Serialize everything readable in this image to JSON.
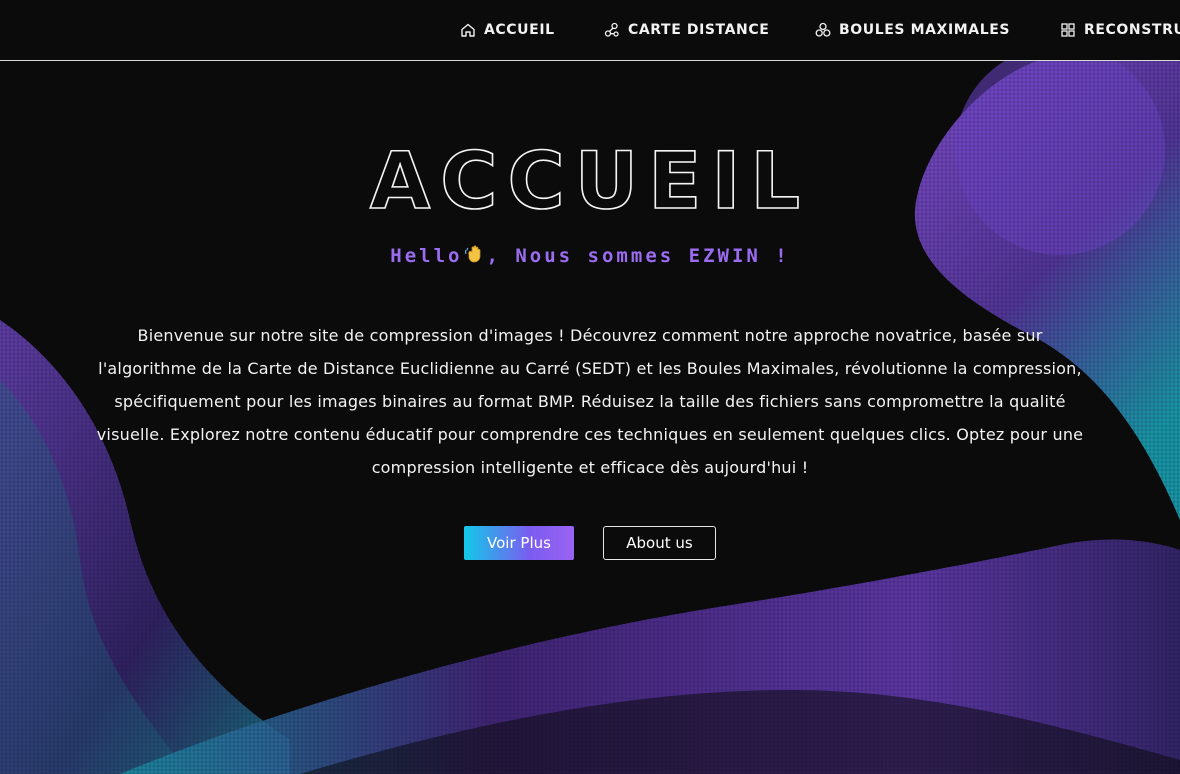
{
  "nav": {
    "items": [
      {
        "label": "ACCUEIL",
        "icon": "home-icon"
      },
      {
        "label": "CARTE DISTANCE",
        "icon": "network-icon"
      },
      {
        "label": "BOULES MAXIMALES",
        "icon": "spheres-icon"
      },
      {
        "label": "RECONSTRU",
        "icon": "blocks-icon"
      }
    ]
  },
  "hero": {
    "title": "ACCUEIL",
    "subtitle_before": "Hello",
    "subtitle_after": ", Nous sommes EZWIN !",
    "description": "Bienvenue sur notre site de compression d'images ! Découvrez comment notre approche novatrice, basée sur l'algorithme de la Carte de Distance Euclidienne au Carré (SEDT) et les Boules Maximales, révolutionne la compression, spécifiquement pour les images binaires au format BMP. Réduisez la taille des fichiers sans compromettre la qualité visuelle. Explorez notre contenu éducatif pour comprendre ces techniques en seulement quelques clics. Optez pour une compression intelligente et efficace dès aujourd'hui !"
  },
  "buttons": {
    "primary": "Voir Plus",
    "secondary": "About us"
  },
  "colors": {
    "background": "#0b0b0c",
    "accent_purple": "#9b6cf0",
    "accent_cyan": "#12c9e8",
    "wave_purple": "#7e4fd6",
    "wave_teal": "#1aa6b8"
  }
}
